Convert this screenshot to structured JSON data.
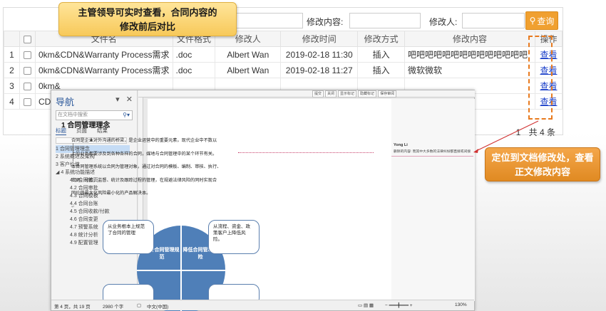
{
  "filters": {
    "content_label": "修改内容:",
    "editor_label": "修改人:",
    "query_label": "查询"
  },
  "table": {
    "headers": [
      "",
      "",
      "文件名",
      "文件格式",
      "修改人",
      "修改时间",
      "修改方式",
      "修改内容",
      "操作"
    ],
    "rows": [
      {
        "num": "1",
        "name": "0km&CDN&Warranty Process需求",
        "format": ".doc",
        "editor": "Albert Wan",
        "time": "2019-02-18 11:30",
        "method": "插入",
        "content": "吧吧吧吧吧吧吧吧吧吧吧吧吧吧",
        "action": "查看"
      },
      {
        "num": "2",
        "name": "0km&CDN&Warranty Process需求",
        "format": ".doc",
        "editor": "Albert Wan",
        "time": "2019-02-18 11:27",
        "method": "插入",
        "content": "微软微软",
        "action": "查看"
      },
      {
        "num": "3",
        "name": "0km&",
        "format": "",
        "editor": "",
        "time": "",
        "method": "",
        "content": "",
        "action": "查看"
      },
      {
        "num": "4",
        "name": "CDN",
        "format": "",
        "editor": "",
        "time": "",
        "method": "",
        "content": "",
        "action": "查看"
      }
    ],
    "pager_total": "共 4 条",
    "pager_page": "1"
  },
  "callouts": {
    "top": "主管领导可实时查看，合同内容的修改前后对比",
    "right": "定位到文档修改处，查看正文修改内容"
  },
  "word": {
    "nav": {
      "title": "导航",
      "search_placeholder": "在文档中搜索",
      "tabs": [
        "标题",
        "页面",
        "结果"
      ],
      "items": [
        {
          "text": "1 合同管理理念",
          "level": 1,
          "selected": true
        },
        {
          "text": "2 系统概述及架构",
          "level": 1
        },
        {
          "text": "3 客户价值",
          "level": 1
        },
        {
          "text": "◢ 4 系统功能描述",
          "level": 1
        },
        {
          "text": "4.1 合同首页",
          "level": 2
        },
        {
          "text": "4.2 合同审批",
          "level": 2
        },
        {
          "text": "4.3 合同模板",
          "level": 2
        },
        {
          "text": "4.4 合同台账",
          "level": 2
        },
        {
          "text": "4.5 合同收款/付款",
          "level": 2
        },
        {
          "text": "4.6 合同变更",
          "level": 2
        },
        {
          "text": "4.7 预警系统",
          "level": 2
        },
        {
          "text": "4.8 统计分析",
          "level": 2
        },
        {
          "text": "4.9 配置管理",
          "level": 2
        }
      ]
    },
    "review_buttons": [
      "提交",
      "关闭",
      "显示标记",
      "隐藏标记",
      "保存审阅"
    ],
    "heading": "1 合同管理理念",
    "paragraphs": [
      "合同是企业对外沟通的桥梁，是企业运营中的重要元素。现代企业中不数以",
      "上的业务都要涉及到各种各样的合同，媒地与合同管理中的某个环节有关。",
      "本合同管理系统以合同为管理对象，通过对合同的模板、编制、审核、执行、",
      "变更、付款、监督、统计及跟踪过程的管理，在规避法律风险的同时实现合",
      "同价值最大化风险最小化的产品解决本。"
    ],
    "comment_author": "Yong Li",
    "comment_body": "删除的内容: 而其中大多数的法律纠纷都直接或间接",
    "diagram": {
      "box_tl": "从业务根本上规范了合同的管理",
      "box_tr": "从流程、资金、政策客户上降低风险。",
      "q_left": "提升合同管理规范",
      "q_right": "降低合同管理风险"
    },
    "status": {
      "page": "第 4 页，共 19 页",
      "words": "2980 个字",
      "lang": "中文(中国)",
      "zoom": "130%"
    }
  }
}
